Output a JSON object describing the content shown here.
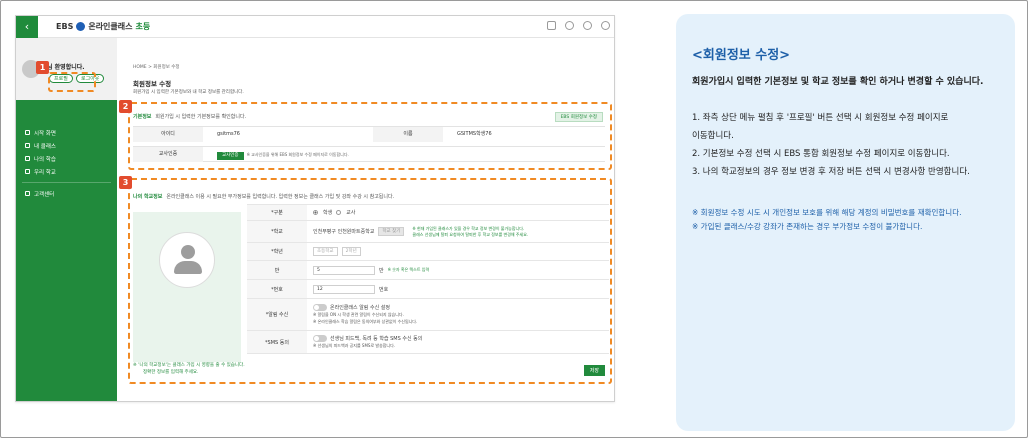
{
  "topbar": {
    "logo_ebs": "EBS",
    "logo_text": "온라인클래스",
    "logo_level": "초등"
  },
  "sidebar": {
    "welcome": "학생님 환영합니다.",
    "profile_btn": "프로필",
    "logout_btn": "로그아웃",
    "menu": [
      "시작 화면",
      "내 클래스",
      "나의 학습",
      "우리 학교",
      "고객센터"
    ]
  },
  "content": {
    "breadcrumb": "HOME > 회원정보 수정",
    "page_title": "회원정보 수정",
    "page_sub": "회원가입 시 입력한 기본정보와 내 학교 정보를 관리합니다.",
    "basic": {
      "head_title": "기본정보",
      "head_desc": "회원가입 시 입력한 기본정보를 확인합니다.",
      "edit_btn": "EBS 회원정보 수정",
      "id_label": "아이디",
      "id_value": "gsitms76",
      "name_label": "이름",
      "name_value": "GSITMS학생76",
      "auth_label": "교사인증",
      "auth_btn": "교사인증",
      "auth_note": "※ 교사인증을 위해 EBS 회원정보 수정 페이지로 이동합니다."
    },
    "school": {
      "head_title": "나의 학교정보",
      "head_desc": "온라인클래스 이용 시 필요한 부가정보를 입력합니다. 입력한 정보는 클래스 가입 및 강좌 수강 시 참고됩니다.",
      "type_label": "*구분",
      "type_opt1": "학생",
      "type_opt2": "교사",
      "school_label": "*학교",
      "school_value": "인천부평구 인천원마트중학교",
      "school_btn": "학교 찾기",
      "school_note": "※ 현재 가입된 클래스가 있을 경우 학교 정보 변경이 불가능합니다.",
      "school_note2": "클래스 선생님께 탈퇴 요청하여 탈퇴한 후 학교 정보를 변경해 주세요.",
      "grade_label": "*학년",
      "grade_value1": "초등학교",
      "grade_value2": "2학년",
      "class_label": "반",
      "class_value": "5",
      "class_unit": "반",
      "class_note": "※ 숫자 혹은 텍스트 입력",
      "number_label": "*번호",
      "number_value": "12",
      "number_unit": "번호",
      "notify_label": "*알림 수신",
      "notify_text": "온라인클래스 알림 수신 설정",
      "notify_note1": "※ 알림을 ON 시 학생 관련 알림이 수신되지 않습니다.",
      "notify_note2": "※ 온라인클래스 학습 알림은 동의여부와 상관없이 수신됩니다.",
      "sms_label": "*SMS 동의",
      "sms_text": "선생님 피드백, 독려 등 학습 SMS 수신 동의",
      "sms_note": "※ 선생님의 피드백과 공지를 SMS로 발송합니다.",
      "bottom_note1": "※ '나의 학교정보'는 클래스 가입 시 영향을 줄 수 있습니다.",
      "bottom_note2": "정확한 정보를 입력해 주세요.",
      "save_btn": "저장"
    }
  },
  "markers": [
    "1",
    "2",
    "3"
  ],
  "panel": {
    "title": "<회원정보 수정>",
    "lead": "회원가입시 입력한 기본정보 및 학교 정보를 확인 하거나 변경할 수 있습니다.",
    "step1a": "1. 좌측 상단 메뉴 펼침 후 '프로필' 버튼 선택 시 회원정보 수정 페이지로",
    "step1b": "이동합니다.",
    "step2": "2. 기본정보 수정 선택 시 EBS 통합 회원정보 수정 페이지로 이동합니다.",
    "step3": "3. 나의 학교정보의 경우 정보 변경 후 저장 버튼 선택 시 변경사항 반영합니다.",
    "note1": "※ 회원정보 수정 시도 시 개인정보 보호를 위해 해당 계정의 비밀번호를 재확인합니다.",
    "note2": "※ 가입된 클래스/수강 강좌가 존재하는 경우 부가정보 수정이 불가합니다."
  },
  "colors": {
    "accent_green": "#218a3c",
    "marker_orange": "#f08a24",
    "panel_blue": "#1d5fa8",
    "panel_bg": "#e4f1fb"
  }
}
